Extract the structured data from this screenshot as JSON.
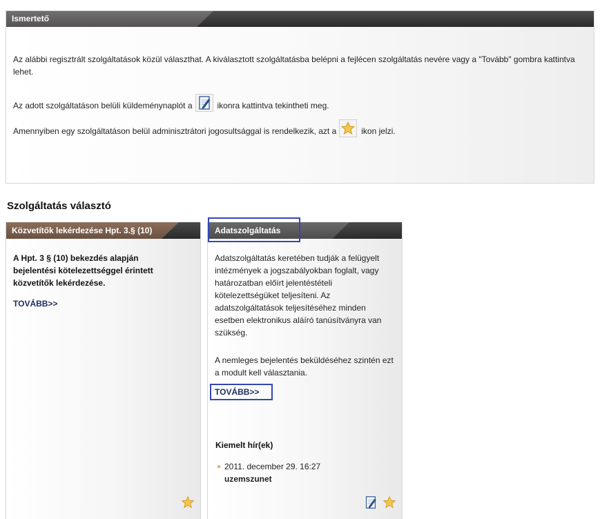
{
  "info": {
    "title": "Ismertető",
    "p1": "Az alábbi regisztrált szolgáltatások közül választhat. A kiválasztott szolgáltatásba belépni a fejlécen szolgáltatás nevére vagy a \"Tovább\" gombra kattintva lehet.",
    "p2_before": "Az adott szolgáltatáson belüli küldeménynaplót a",
    "p2_after": "ikonra kattintva tekintheti meg.",
    "p3_before": "Amennyiben egy szolgáltatáson belül adminisztrátori jogosultsággal is rendelkezik, azt a",
    "p3_after": "ikon jelzi.",
    "icon_log": "edit-log-icon",
    "icon_admin": "admin-star-icon"
  },
  "selector": {
    "title": "Szolgáltatás választó"
  },
  "cards": [
    {
      "title": "Közvetítők lekérdezése Hpt. 3.§ (10)",
      "description": "A Hpt. 3 § (10) bekezdés alapján bejelentési kötelezettséggel érintett közvetítők lekérdezése.",
      "more": "TOVÁBB>>",
      "icons": [
        "admin-star-icon"
      ]
    },
    {
      "title": "Adatszolgáltatás",
      "description": "Adatszolgáltatás keretében tudják a felügyelt intézmények a jogszabályokban foglalt, vagy határozatban előírt jelentéstételi kötelezettségüket teljesíteni. Az adatszolgáltatások teljesítéséhez minden esetben elektronikus aláíró tanúsítványra van szükség.",
      "description2": "A nemleges bejelentés beküldéséhez szintén ezt a modult kell választania.",
      "more": "TOVÁBB>>",
      "news_title": "Kiemelt hír(ek)",
      "news": [
        {
          "date": "2011. december 29.  16:27",
          "link": "uzemszunet"
        }
      ],
      "icons": [
        "edit-log-icon",
        "admin-star-icon"
      ]
    }
  ],
  "colors": {
    "header_dark": "#2b2b2b",
    "tab_brown": "#6b5141",
    "highlight": "#3445b5",
    "link": "#1b2b5c"
  }
}
